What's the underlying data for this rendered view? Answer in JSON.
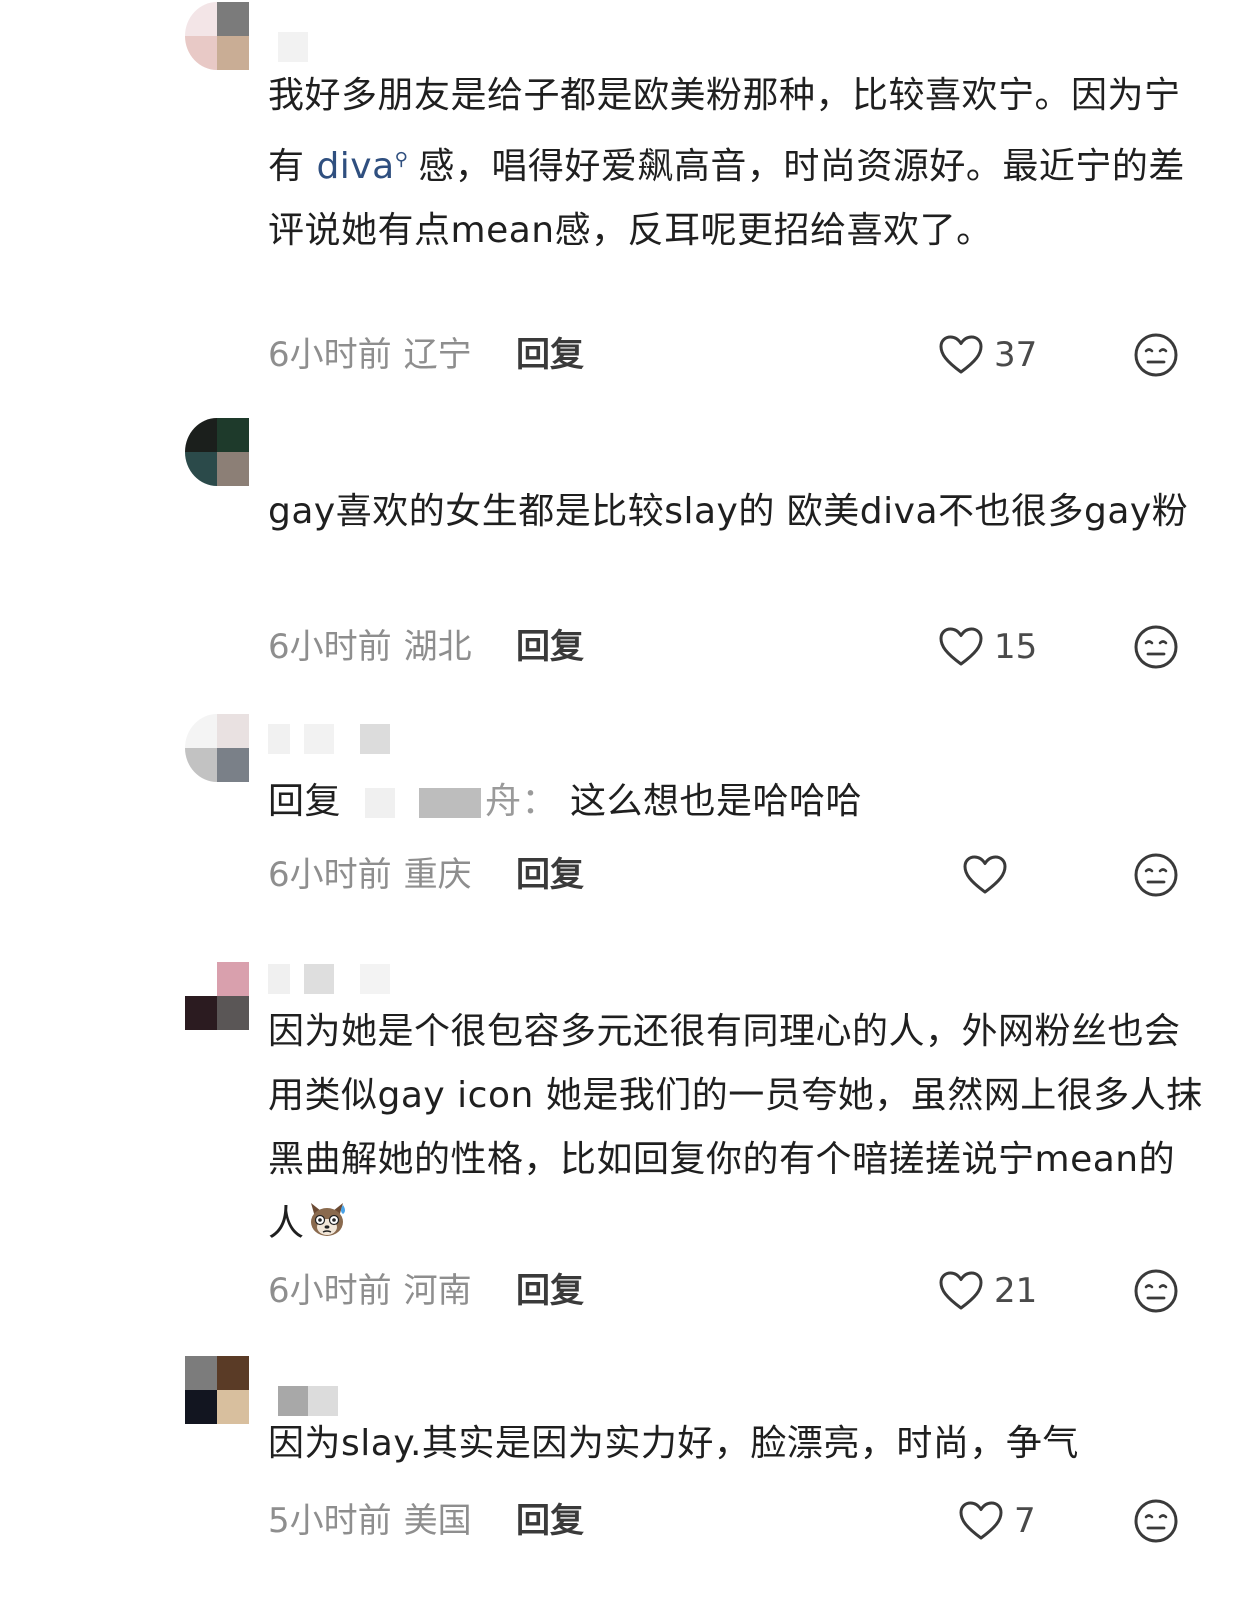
{
  "colors": {
    "text": "#1f1f1f",
    "meta": "#8e8e8e",
    "link": "#2f4f7f",
    "icon": "#3a3a3a"
  },
  "icons": {
    "like": "heart-outline-icon",
    "dislike": "neutral-face-icon",
    "link": "search-icon"
  },
  "reply_label": "回复",
  "comments": [
    {
      "lines_pre": "我好多朋友是给子都是欧美粉那种，比较喜欢宁。因为宁有 ",
      "link": "diva",
      "lines_post": "感，唱得好爱飙高音，时尚资源好。最近宁的差评说她有点mean感，反耳呢更招给喜欢了。",
      "time": "6小时前",
      "region": "辽宁",
      "likes": "37"
    },
    {
      "text": "gay喜欢的女生都是比较slay的 欧美diva不也很多gay粉",
      "time": "6小时前",
      "region": "湖北",
      "likes": "15"
    },
    {
      "reply_prefix": "回复",
      "reply_suffix": "舟：",
      "text": "这么想也是哈哈哈",
      "time": "6小时前",
      "region": "重庆",
      "likes": ""
    },
    {
      "text": "因为她是个很包容多元还很有同理心的人，外网粉丝也会用类似gay icon 她是我们的一员夸她，虽然网上很多人抹黑曲解她的性格，比如回复你的有个暗搓搓说宁mean的人",
      "emoji": "sweating-dog-emoji",
      "time": "6小时前",
      "region": "河南",
      "likes": "21"
    },
    {
      "text": "因为slay.其实是因为实力好，脸漂亮，时尚，争气",
      "time": "5小时前",
      "region": "美国",
      "likes": "7"
    }
  ]
}
